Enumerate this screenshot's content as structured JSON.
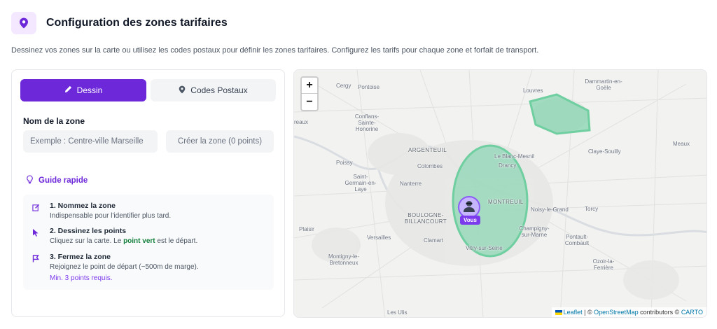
{
  "header": {
    "title": "Configuration des zones tarifaires",
    "icon": "map-pin-icon",
    "description": "Dessinez vos zones sur la carte ou utilisez les codes postaux pour définir les zones tarifaires. Configurez les tarifs pour chaque zone et forfait de transport."
  },
  "panel": {
    "modes": {
      "draw_label": "Dessin",
      "postal_label": "Codes Postaux"
    },
    "zone_name_label": "Nom de la zone",
    "zone_name_placeholder": "Exemple : Centre-ville Marseille",
    "create_button_label": "Créer la zone (0 points)",
    "guide": {
      "title": "Guide rapide",
      "steps": [
        {
          "title": "1. Nommez la zone",
          "desc": "Indispensable pour l'identifier plus tard.",
          "icon": "edit-icon"
        },
        {
          "title": "2. Dessinez les points",
          "desc_before": "Cliquez sur la carte. Le",
          "desc_highlight": "point vert",
          "desc_after": "est le départ.",
          "icon": "cursor-icon"
        },
        {
          "title": "3. Fermez la zone",
          "desc": "Rejoignez le point de départ (~500m de marge).",
          "note": "Min. 3 points requis.",
          "icon": "flag-icon"
        }
      ]
    }
  },
  "map": {
    "zoom_in": "+",
    "zoom_out": "−",
    "you_label": "Vous",
    "attribution": {
      "leaflet": "Leaflet",
      "sep": " | © ",
      "osm": "OpenStreetMap",
      "contributors": " contributors © ",
      "carto": "CARTO"
    },
    "places": {
      "cergy": "Cergy",
      "pontoise": "Pontoise",
      "louvres": "Louvres",
      "dammartin": "Dammartin-en-Goële",
      "conflans": "Conflans-Sainte-Honorine",
      "reaux": "reaux",
      "argenteuil": "ARGENTEUIL",
      "blanc_mesnil": "Le Blanc-Mesnil",
      "claye": "Claye-Souilly",
      "meaux": "Meaux",
      "poissy": "Poissy",
      "colombes": "Colombes",
      "drancy": "Drancy",
      "saint_germain": "Saint-Germain-en-Laye",
      "nanterre": "Nanterre",
      "montreuil": "MONTREUIL",
      "noisy": "Noisy-le-Grand",
      "torcy": "Torcy",
      "boulogne": "BOULOGNE-BILLANCOURT",
      "plaisir": "Plaisir",
      "versailles": "Versailles",
      "clamart": "Clamart",
      "champigny": "Champigny-sur-Marne",
      "pontault": "Pontault-Combault",
      "vitry": "Vitry-sur-Seine",
      "montigny": "Montigny-le-Bretonneux",
      "ozoir": "Ozoir-la-Ferrière",
      "les_ulis": "Les Ulis"
    },
    "zone_color": "#86d4b0"
  },
  "colors": {
    "accent": "#6d28d9",
    "zone_fill": "#86d4b0",
    "zone_stroke": "#6fcfa0"
  }
}
